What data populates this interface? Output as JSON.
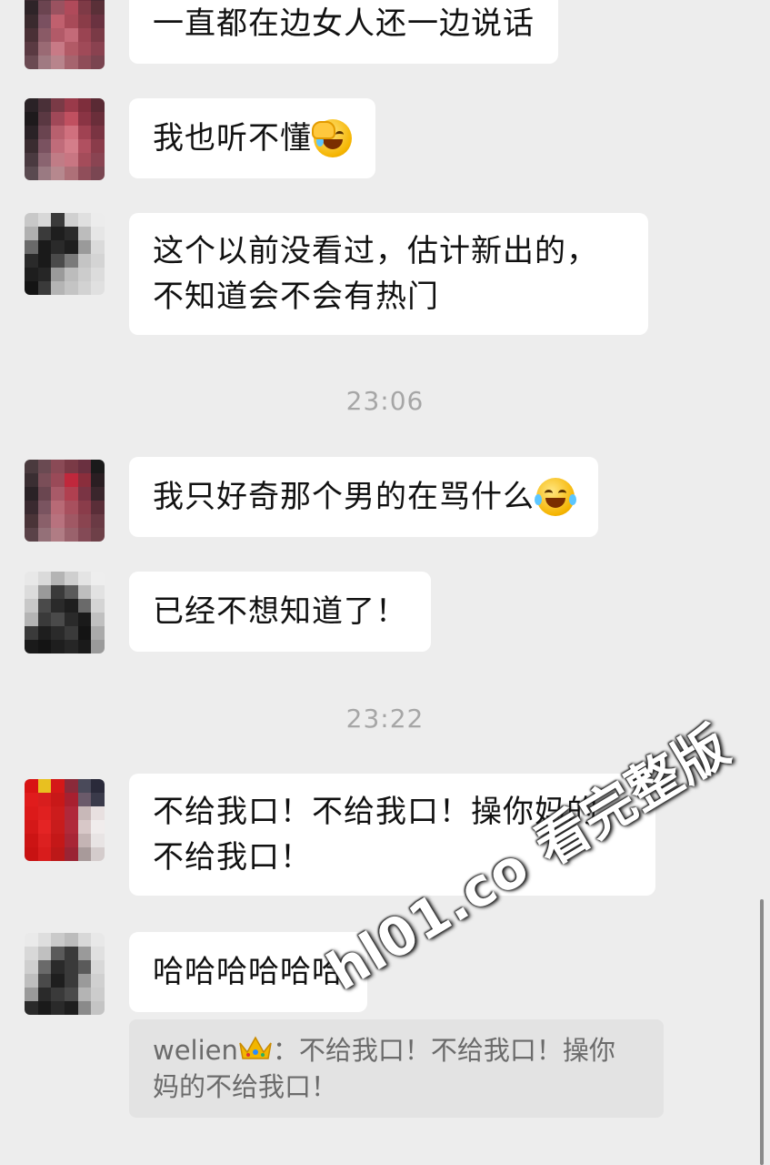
{
  "messages": [
    {
      "text": "一直都在边女人还一边说话"
    },
    {
      "text": "我也听不懂",
      "emoji": "facepalm-emoji"
    },
    {
      "text": "这个以前没看过，估计新出的，\n不知道会不会有热门"
    },
    {
      "text": "我只好奇那个男的在骂什么",
      "emoji": "tears-of-joy-emoji"
    },
    {
      "text": "已经不想知道了！"
    },
    {
      "text": "不给我口！不给我口！操你妈的\n不给我口！"
    },
    {
      "text": "哈哈哈哈哈哈"
    }
  ],
  "timestamps": [
    "23:06",
    "23:22"
  ],
  "quote": {
    "author": "welien",
    "author_badge": "crown-icon",
    "separator": "：",
    "text": "不给我口！不给我口！操你妈的不给我口！"
  },
  "watermark": "hl01.co 看完整版",
  "colors": {
    "background": "#ededed",
    "bubble": "#ffffff",
    "quote_bg": "#e3e3e3",
    "timestamp": "#a6a6a6"
  }
}
